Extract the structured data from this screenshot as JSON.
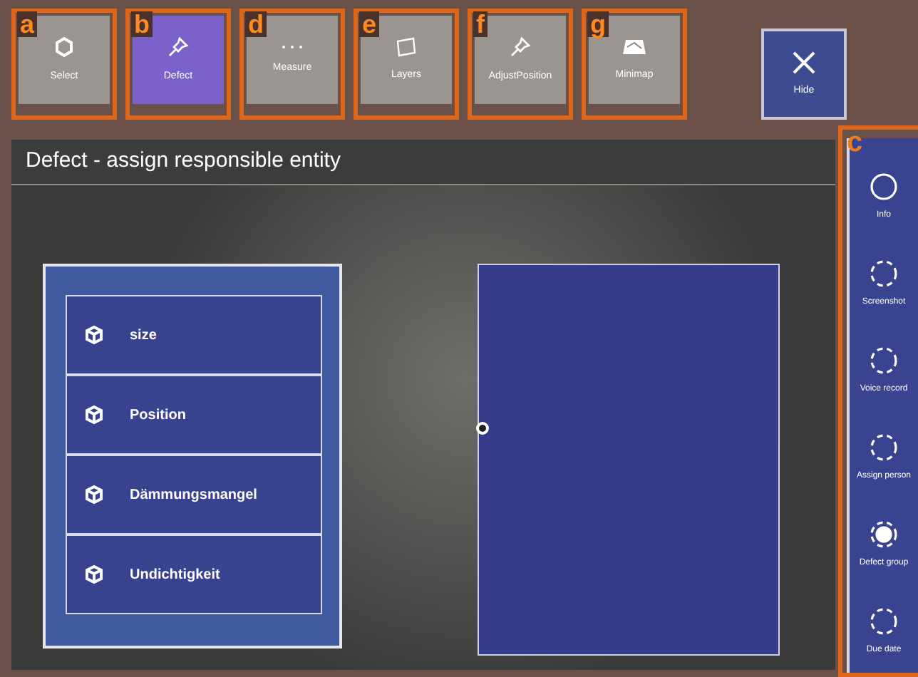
{
  "toolbar": [
    {
      "annotation": "a",
      "label": "Select",
      "selected": false
    },
    {
      "annotation": "b",
      "label": "Defect",
      "selected": true
    },
    {
      "annotation": "d",
      "label": "Measure",
      "selected": false
    },
    {
      "annotation": "e",
      "label": "Layers",
      "selected": false
    },
    {
      "annotation": "f",
      "label": "AdjustPosition",
      "selected": false
    },
    {
      "annotation": "g",
      "label": "Minimap",
      "selected": false
    }
  ],
  "hide_button": {
    "label": "Hide"
  },
  "panel": {
    "title": "Defect - assign responsible entity",
    "entities": [
      {
        "label": "size"
      },
      {
        "label": "Position"
      },
      {
        "label": "Dämmungsmangel"
      },
      {
        "label": "Undichtigkeit"
      }
    ]
  },
  "side_menu": {
    "annotation": "c",
    "items": [
      {
        "label": "Info",
        "kind": "solid",
        "filled": false
      },
      {
        "label": "Screenshot",
        "kind": "dashed",
        "filled": false
      },
      {
        "label": "Voice record",
        "kind": "dashed",
        "filled": false
      },
      {
        "label": "Assign person",
        "kind": "dashed",
        "filled": false
      },
      {
        "label": "Defect group",
        "kind": "dashed",
        "filled": true
      },
      {
        "label": "Due date",
        "kind": "dashed",
        "filled": false
      }
    ]
  }
}
